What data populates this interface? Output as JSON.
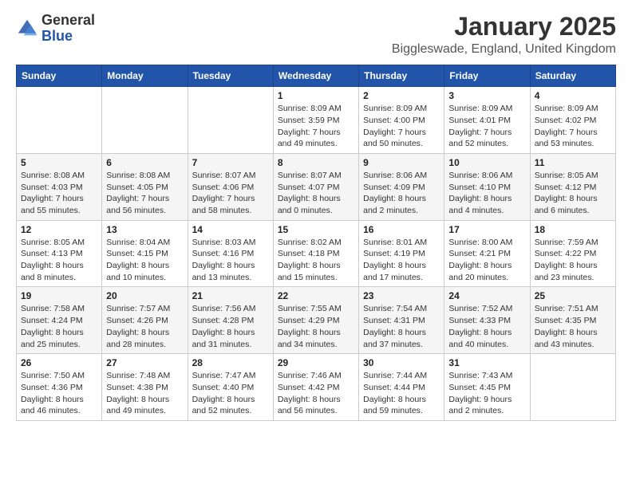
{
  "header": {
    "logo": {
      "general": "General",
      "blue": "Blue"
    },
    "title": "January 2025",
    "location": "Biggleswade, England, United Kingdom"
  },
  "calendar": {
    "weekdays": [
      "Sunday",
      "Monday",
      "Tuesday",
      "Wednesday",
      "Thursday",
      "Friday",
      "Saturday"
    ],
    "weeks": [
      [
        {
          "day": "",
          "info": ""
        },
        {
          "day": "",
          "info": ""
        },
        {
          "day": "",
          "info": ""
        },
        {
          "day": "1",
          "info": "Sunrise: 8:09 AM\nSunset: 3:59 PM\nDaylight: 7 hours\nand 49 minutes."
        },
        {
          "day": "2",
          "info": "Sunrise: 8:09 AM\nSunset: 4:00 PM\nDaylight: 7 hours\nand 50 minutes."
        },
        {
          "day": "3",
          "info": "Sunrise: 8:09 AM\nSunset: 4:01 PM\nDaylight: 7 hours\nand 52 minutes."
        },
        {
          "day": "4",
          "info": "Sunrise: 8:09 AM\nSunset: 4:02 PM\nDaylight: 7 hours\nand 53 minutes."
        }
      ],
      [
        {
          "day": "5",
          "info": "Sunrise: 8:08 AM\nSunset: 4:03 PM\nDaylight: 7 hours\nand 55 minutes."
        },
        {
          "day": "6",
          "info": "Sunrise: 8:08 AM\nSunset: 4:05 PM\nDaylight: 7 hours\nand 56 minutes."
        },
        {
          "day": "7",
          "info": "Sunrise: 8:07 AM\nSunset: 4:06 PM\nDaylight: 7 hours\nand 58 minutes."
        },
        {
          "day": "8",
          "info": "Sunrise: 8:07 AM\nSunset: 4:07 PM\nDaylight: 8 hours\nand 0 minutes."
        },
        {
          "day": "9",
          "info": "Sunrise: 8:06 AM\nSunset: 4:09 PM\nDaylight: 8 hours\nand 2 minutes."
        },
        {
          "day": "10",
          "info": "Sunrise: 8:06 AM\nSunset: 4:10 PM\nDaylight: 8 hours\nand 4 minutes."
        },
        {
          "day": "11",
          "info": "Sunrise: 8:05 AM\nSunset: 4:12 PM\nDaylight: 8 hours\nand 6 minutes."
        }
      ],
      [
        {
          "day": "12",
          "info": "Sunrise: 8:05 AM\nSunset: 4:13 PM\nDaylight: 8 hours\nand 8 minutes."
        },
        {
          "day": "13",
          "info": "Sunrise: 8:04 AM\nSunset: 4:15 PM\nDaylight: 8 hours\nand 10 minutes."
        },
        {
          "day": "14",
          "info": "Sunrise: 8:03 AM\nSunset: 4:16 PM\nDaylight: 8 hours\nand 13 minutes."
        },
        {
          "day": "15",
          "info": "Sunrise: 8:02 AM\nSunset: 4:18 PM\nDaylight: 8 hours\nand 15 minutes."
        },
        {
          "day": "16",
          "info": "Sunrise: 8:01 AM\nSunset: 4:19 PM\nDaylight: 8 hours\nand 17 minutes."
        },
        {
          "day": "17",
          "info": "Sunrise: 8:00 AM\nSunset: 4:21 PM\nDaylight: 8 hours\nand 20 minutes."
        },
        {
          "day": "18",
          "info": "Sunrise: 7:59 AM\nSunset: 4:22 PM\nDaylight: 8 hours\nand 23 minutes."
        }
      ],
      [
        {
          "day": "19",
          "info": "Sunrise: 7:58 AM\nSunset: 4:24 PM\nDaylight: 8 hours\nand 25 minutes."
        },
        {
          "day": "20",
          "info": "Sunrise: 7:57 AM\nSunset: 4:26 PM\nDaylight: 8 hours\nand 28 minutes."
        },
        {
          "day": "21",
          "info": "Sunrise: 7:56 AM\nSunset: 4:28 PM\nDaylight: 8 hours\nand 31 minutes."
        },
        {
          "day": "22",
          "info": "Sunrise: 7:55 AM\nSunset: 4:29 PM\nDaylight: 8 hours\nand 34 minutes."
        },
        {
          "day": "23",
          "info": "Sunrise: 7:54 AM\nSunset: 4:31 PM\nDaylight: 8 hours\nand 37 minutes."
        },
        {
          "day": "24",
          "info": "Sunrise: 7:52 AM\nSunset: 4:33 PM\nDaylight: 8 hours\nand 40 minutes."
        },
        {
          "day": "25",
          "info": "Sunrise: 7:51 AM\nSunset: 4:35 PM\nDaylight: 8 hours\nand 43 minutes."
        }
      ],
      [
        {
          "day": "26",
          "info": "Sunrise: 7:50 AM\nSunset: 4:36 PM\nDaylight: 8 hours\nand 46 minutes."
        },
        {
          "day": "27",
          "info": "Sunrise: 7:48 AM\nSunset: 4:38 PM\nDaylight: 8 hours\nand 49 minutes."
        },
        {
          "day": "28",
          "info": "Sunrise: 7:47 AM\nSunset: 4:40 PM\nDaylight: 8 hours\nand 52 minutes."
        },
        {
          "day": "29",
          "info": "Sunrise: 7:46 AM\nSunset: 4:42 PM\nDaylight: 8 hours\nand 56 minutes."
        },
        {
          "day": "30",
          "info": "Sunrise: 7:44 AM\nSunset: 4:44 PM\nDaylight: 8 hours\nand 59 minutes."
        },
        {
          "day": "31",
          "info": "Sunrise: 7:43 AM\nSunset: 4:45 PM\nDaylight: 9 hours\nand 2 minutes."
        },
        {
          "day": "",
          "info": ""
        }
      ]
    ]
  }
}
